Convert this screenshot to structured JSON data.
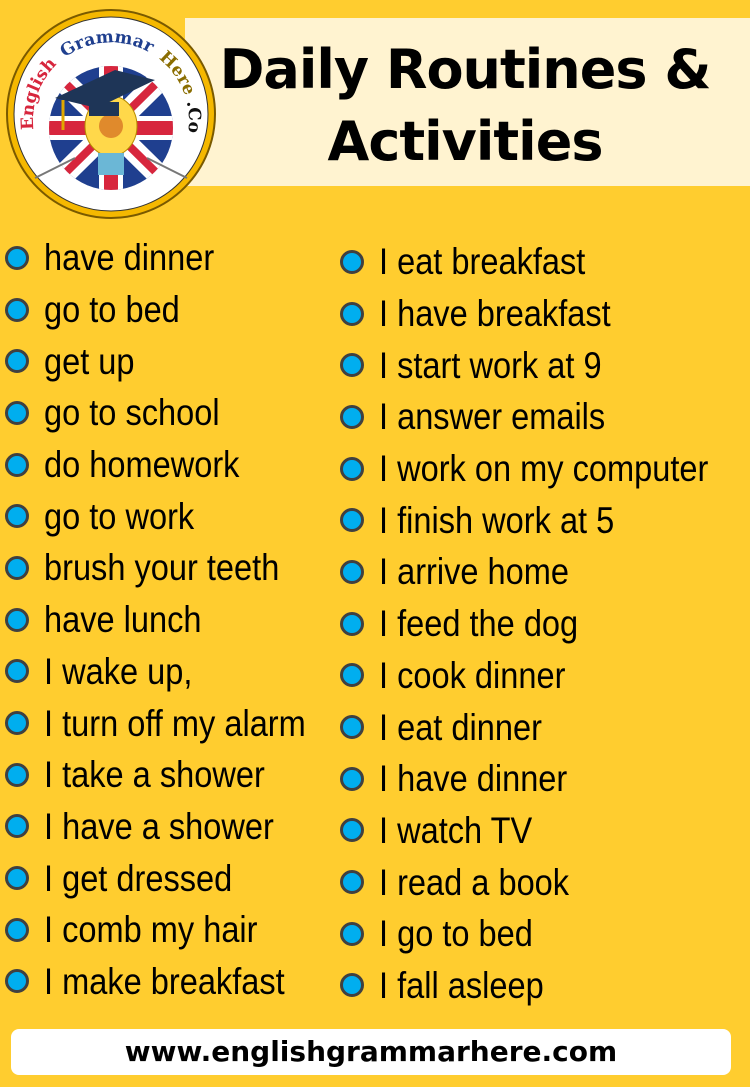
{
  "header": {
    "title_line1": "Daily Routines &",
    "title_line2": "Activities"
  },
  "logo": {
    "text_english": "English",
    "text_grammar": "Grammar",
    "text_here": "Here",
    "text_com": ".Com",
    "icon": "graduation-cap-lightbulb-uk-flag-logo"
  },
  "colors": {
    "background": "#FFCD2F",
    "title_band": "#FFF3D0",
    "bullet_fill": "#00AEEF",
    "bullet_border": "#404040"
  },
  "left_column": [
    "have dinner",
    "go to bed",
    "get up",
    "go to school",
    "do homework",
    "go to work",
    "brush your teeth",
    "have lunch",
    "I wake up,",
    "I turn off my alarm",
    "I take a shower",
    "I have a shower",
    "I get dressed",
    "I comb my hair",
    "I make breakfast"
  ],
  "right_column": [
    "I eat breakfast",
    "I have breakfast",
    "I start work at 9",
    "I answer emails",
    "I work on my computer",
    "I finish work at 5",
    "I arrive home",
    "I feed the dog",
    "I cook dinner",
    "I eat dinner",
    "I have dinner",
    "I watch TV",
    "I read a book",
    "I go to bed",
    "I fall asleep"
  ],
  "footer": {
    "url": "www.englishgrammarhere.com"
  }
}
